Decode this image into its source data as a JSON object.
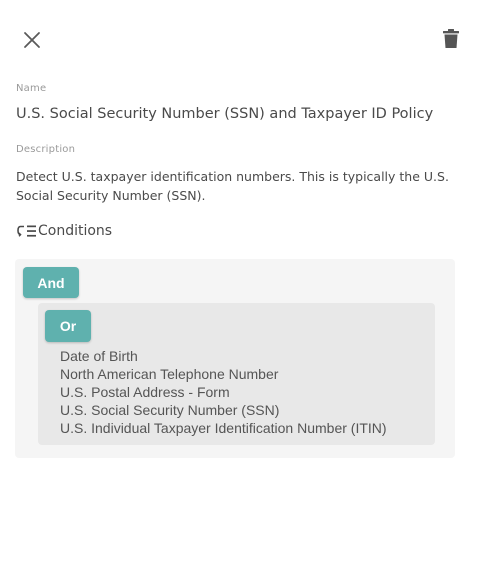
{
  "toolbar": {
    "close_icon": "close-icon",
    "delete_icon": "trash-icon"
  },
  "policy": {
    "name_label": "Name",
    "name": "U.S. Social Security Number (SSN) and Taxpayer ID Policy",
    "description_label": "Description",
    "description": "Detect U.S. taxpayer identification numbers. This is typically the U.S. Social Security Number (SSN)."
  },
  "conditions": {
    "header": "Conditions",
    "header_icon": "conditions-icon",
    "root_operator": "And",
    "group_operator": "Or",
    "items": [
      "Date of Birth",
      "North American Telephone Number",
      "U.S. Postal Address - Form",
      "U.S. Social Security Number (SSN)",
      "U.S. Individual Taxpayer Identification Number (ITIN)"
    ]
  },
  "colors": {
    "operator_button": "#5fb1ae",
    "and_group_bg": "#f5f5f5",
    "or_group_bg": "#e8e8e8"
  }
}
